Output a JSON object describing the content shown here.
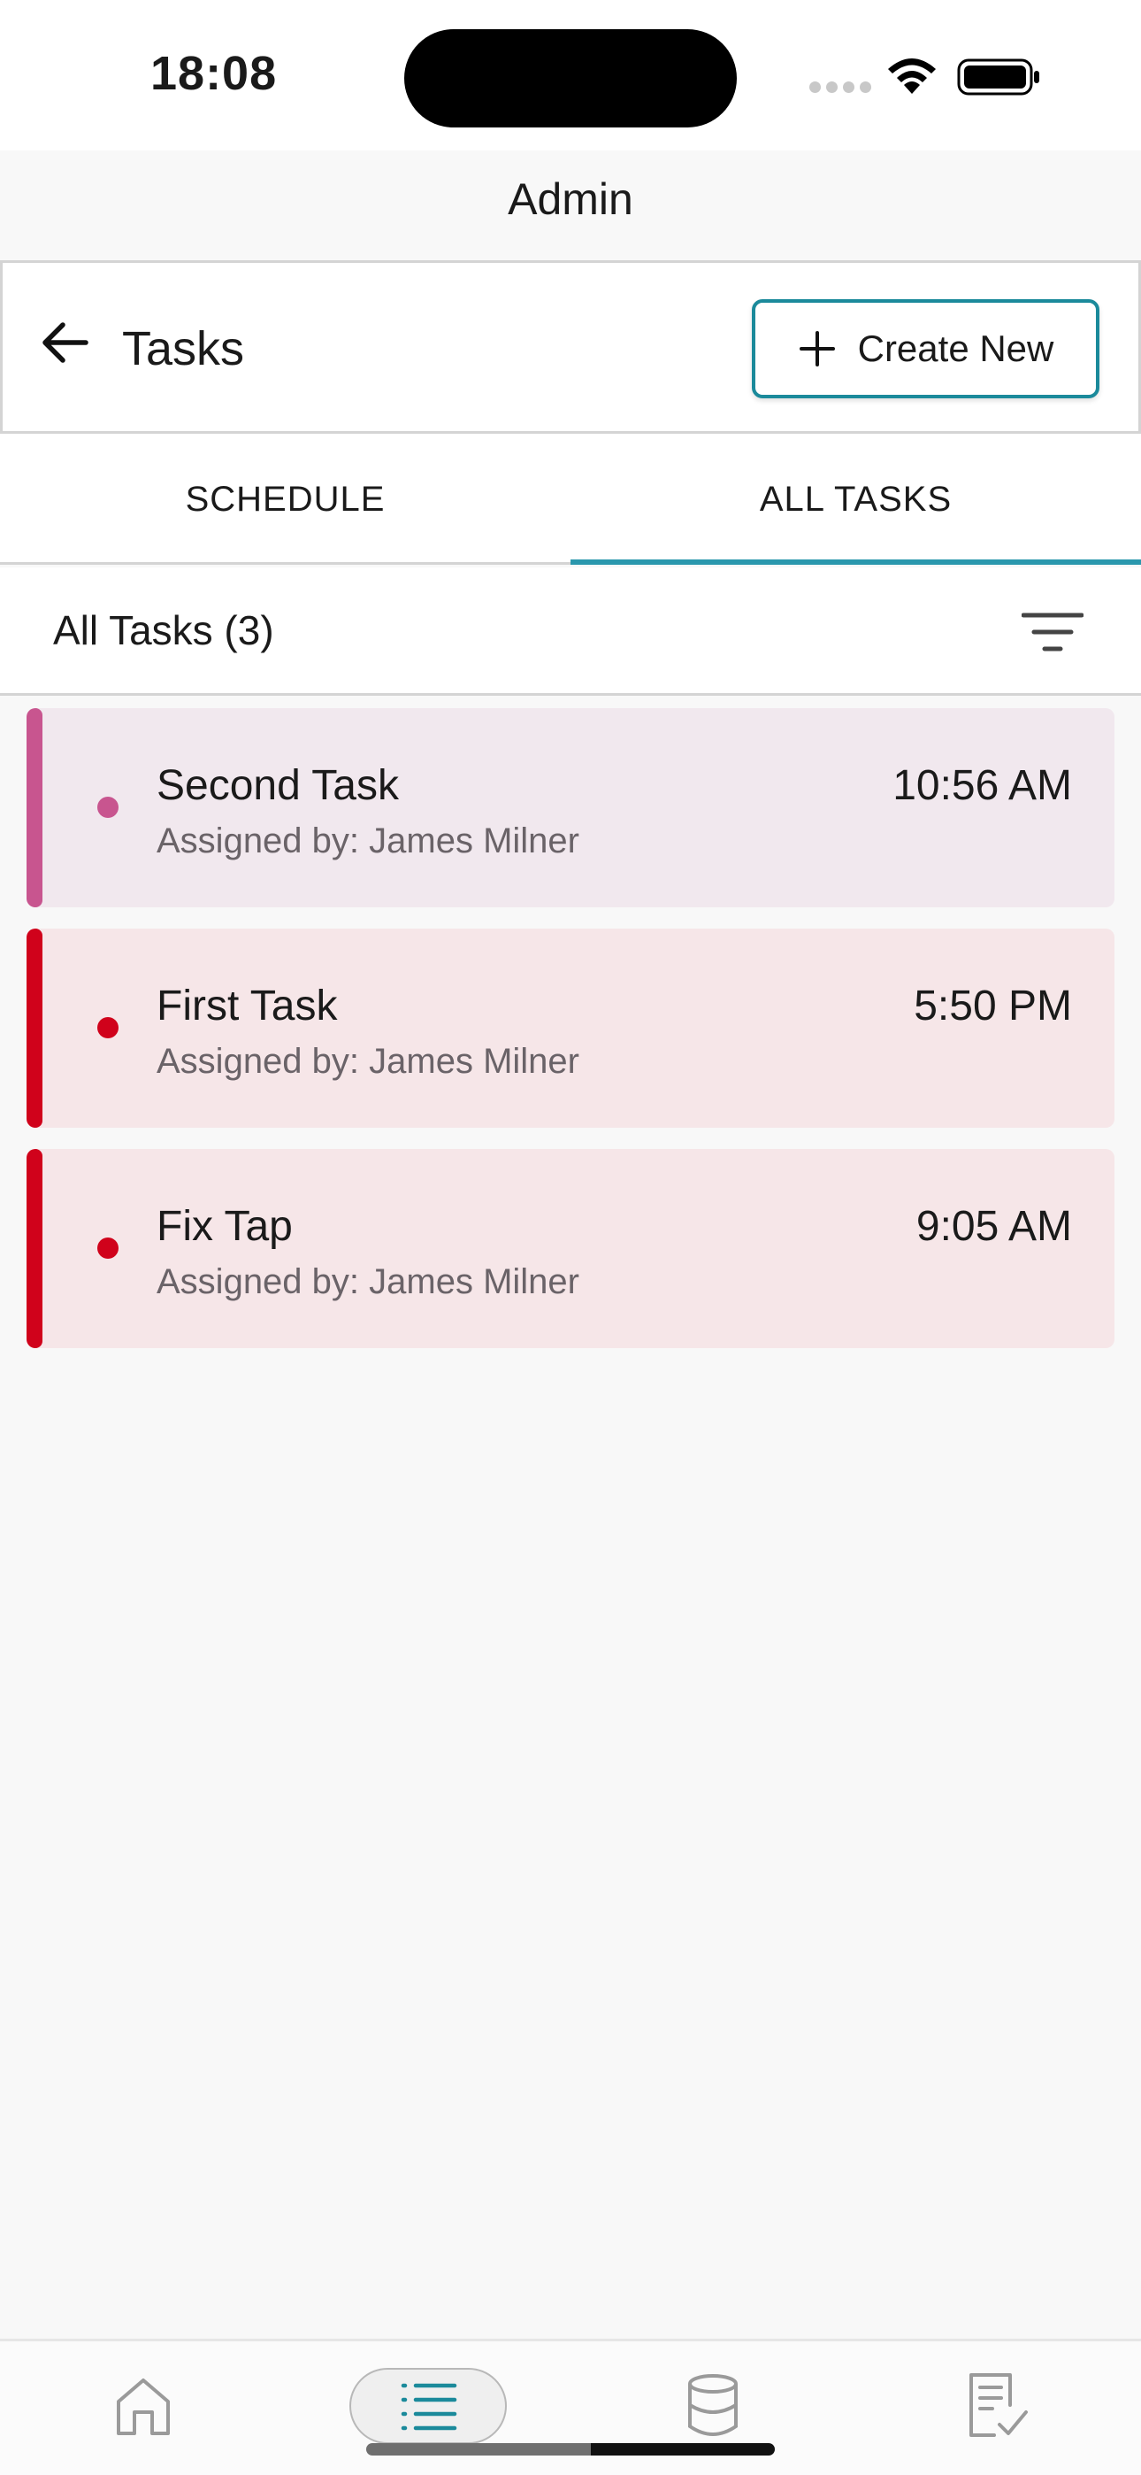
{
  "status_bar": {
    "time": "18:08"
  },
  "app": {
    "title": "Admin"
  },
  "header": {
    "title": "Tasks",
    "create_label": "Create New"
  },
  "tabs": [
    {
      "label": "SCHEDULE",
      "active": false
    },
    {
      "label": "ALL TASKS",
      "active": true
    }
  ],
  "list": {
    "count_label": "All Tasks (3)"
  },
  "tasks": [
    {
      "name": "Second Task",
      "assigned": "Assigned by: James Milner",
      "time": "10:56 AM",
      "accent": "#c8558f",
      "bg": "#f1e8ee"
    },
    {
      "name": "First Task",
      "assigned": "Assigned by: James Milner",
      "time": "5:50 PM",
      "accent": "#d0021b",
      "bg": "#f6e6e8"
    },
    {
      "name": "Fix Tap",
      "assigned": "Assigned by: James Milner",
      "time": "9:05 AM",
      "accent": "#d0021b",
      "bg": "#f6e6e8"
    }
  ],
  "bottom_nav": [
    {
      "icon": "home-icon",
      "active": false
    },
    {
      "icon": "list-icon",
      "active": true
    },
    {
      "icon": "database-icon",
      "active": false
    },
    {
      "icon": "checklist-icon",
      "active": false
    }
  ],
  "colors": {
    "accent": "#1b8a9b",
    "tab_indicator": "#2a97ad"
  }
}
